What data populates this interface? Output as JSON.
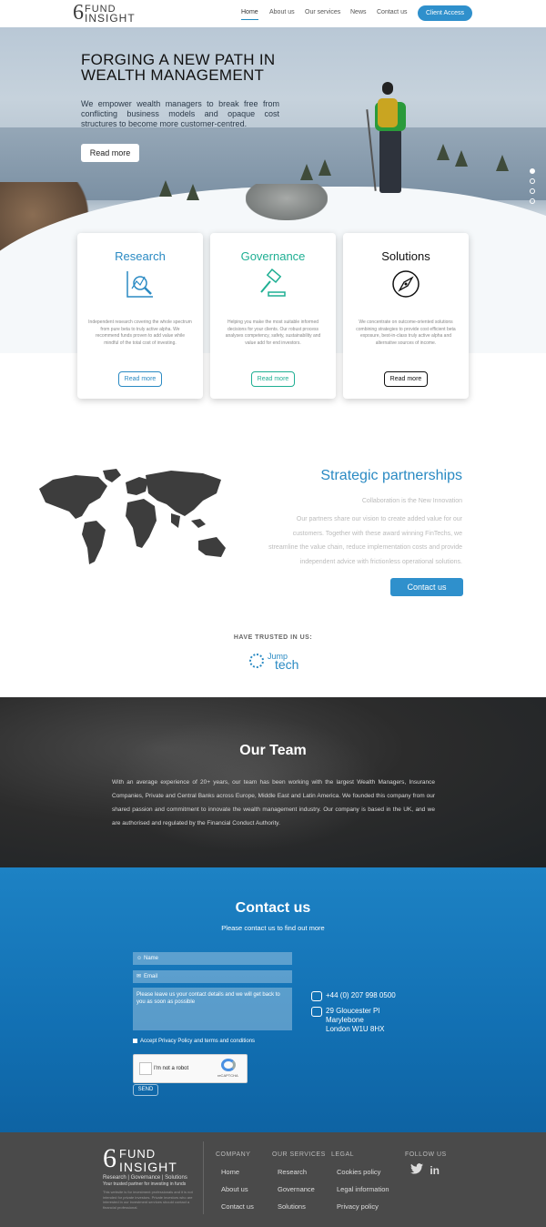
{
  "nav": {
    "logo_top": "FUND",
    "logo_bottom": "INSIGHT",
    "logo_numeral": "6",
    "items": [
      "Home",
      "About us",
      "Our services",
      "News",
      "Contact us"
    ],
    "client_access": "Client Access"
  },
  "hero": {
    "title_line1": "FORGING A NEW PATH IN",
    "title_line2": "WEALTH MANAGEMENT",
    "text": "We empower wealth managers to break free from conflicting business models and opaque cost structures to become more customer-centred.",
    "button": "Read more"
  },
  "cards": [
    {
      "title": "Research",
      "text": "Independent research covering the whole spectrum from pure beta to truly active alpha. We recommend funds proven to add value while mindful of the total cost of investing.",
      "button": "Read more",
      "icon": "magnifier-chart-icon"
    },
    {
      "title": "Governance",
      "text": "Helping you make the most suitable informed decisions for your clients. Our robust process analyses competency, safety, sustainability and value add for end investors.",
      "button": "Read more",
      "icon": "gavel-icon"
    },
    {
      "title": "Solutions",
      "text": "We concentrate on outcome-oriented solutions combining strategies to provide cost efficient beta exposure, best-in-class truly active alpha and alternative sources of income.",
      "button": "Read more",
      "icon": "compass-icon"
    }
  ],
  "partnerships": {
    "title": "Strategic partnerships",
    "subtitle": "Collaboration is the New Innovation",
    "body": "Our partners share our vision to create added value for our customers. Together with these award winning FinTechs, we streamline the value chain, reduce implementation costs and provide independent advice with frictionless operational solutions.",
    "button": "Contact us",
    "trusted": "HAVE TRUSTED IN US:",
    "partner_small": "Jump",
    "partner_big": "tech"
  },
  "team": {
    "title": "Our Team",
    "text": "With an average experience of 20+ years, our team has been working with the largest Wealth Managers, Insurance Companies, Private and  Central Banks across Europe, Middle East and Latin America. We founded this company from our shared passion and commitment to innovate the wealth management industry. Our company is based in the UK, and we are authorised and regulated by the Financial Conduct Authority."
  },
  "contact": {
    "title": "Contact us",
    "subtitle": "Please contact us to find out more",
    "name_placeholder": "Name",
    "email_placeholder": "Email",
    "message_placeholder": "Please leave us your contact details and we will get back to you as soon as possible",
    "accept": "Accept Privacy Policy and terms and conditions",
    "captcha_label": "I'm not a robot",
    "captcha_brand": "reCAPTCHA",
    "captcha_terms": "Privacy - Terms",
    "send": "SEND",
    "phone": "+44 (0) 207 998 0500",
    "address": [
      "29 Gloucester Pl",
      "Marylebone",
      "London W1U 8HX"
    ]
  },
  "footer": {
    "logo_top": "FUND",
    "logo_bottom": "INSIGHT",
    "tagline": "Research | Governance | Solutions",
    "tagline2": "Your trusted partner for investing in funds",
    "disclaimer": "This website is for investment professionals and it is not intended for private investors. Private investors who are interested in our investment services should contact a financial professional.",
    "columns": [
      {
        "heading": "COMPANY",
        "links": [
          "Home",
          "About us",
          "Contact us"
        ]
      },
      {
        "heading": "OUR SERVICES",
        "links": [
          "Research",
          "Governance",
          "Solutions"
        ]
      },
      {
        "heading": "LEGAL",
        "links": [
          "Cookies policy",
          "Legal information",
          "Privacy policy"
        ]
      }
    ],
    "follow": "FOLLOW US",
    "social": [
      "twitter-icon",
      "linkedin-icon"
    ]
  },
  "colors": {
    "accent": "#2f90cc",
    "research": "#2a8ac3",
    "governance": "#1faf93",
    "contact_bg": "#1874b8",
    "footer_bg": "#4a4a4a"
  }
}
